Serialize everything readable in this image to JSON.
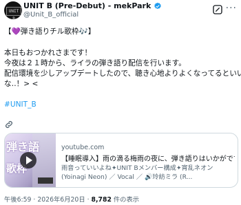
{
  "account": {
    "name": "UNIT B (Pre-Debut) - mekPark",
    "handle": "@Unit_B_official",
    "avatar_text": "UNIT B"
  },
  "tweet": {
    "lines": [
      "【💜弾き語りチル歌枠🎶】",
      "",
      "本日もおつかれさまです！",
      "今夜は２１時から、ライラの弾き語り配信を行います。",
      "配信環境を少しアップデートしたので、聴き心地よりよくなってるといい",
      "な‥！> <"
    ],
    "hashtag": "#UNIT_B"
  },
  "card": {
    "domain": "youtube.com",
    "title": "【睡眠導入】雨の滴る梅雨の夜に、弾き語りはいかがです…",
    "desc_line1": "雨音っていいよね✦UNIT Bメンバー構成✦宵乱ネオン",
    "desc_line2": "(Yoinagi Neon) ／ Vocal ／ 🔊玲紡ミラ (R...",
    "thumb_text1": "弾き語",
    "thumb_text2": "歌枠"
  },
  "meta": {
    "time": "午後6:59 · 2026年6月20日 · ",
    "views_count": "8,782",
    "views_label": " 件の表示"
  },
  "colors": {
    "accent": "#1d9bf0",
    "muted": "#536471",
    "text": "#0f1419",
    "verified": "#1d9bf0"
  },
  "icons": [
    "verified-badge-icon",
    "grok-icon",
    "more-icon",
    "link-icon",
    "play-icon"
  ]
}
